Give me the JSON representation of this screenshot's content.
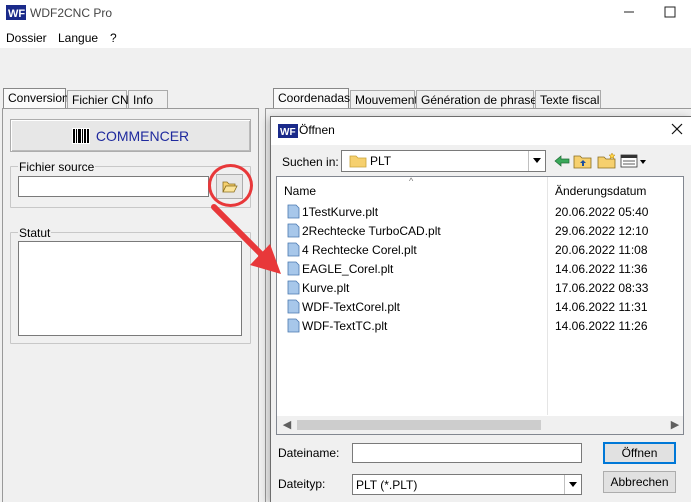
{
  "window": {
    "title": "WDF2CNC Pro",
    "app_icon": "wdf-app-icon",
    "controls": [
      "minimize-icon",
      "maximize-icon"
    ]
  },
  "menubar": {
    "items": [
      {
        "label": "Dossier"
      },
      {
        "label": "Langue"
      },
      {
        "label": "?"
      }
    ]
  },
  "left_tabs": [
    {
      "label": "Conversion",
      "active": true
    },
    {
      "label": "Fichier CN",
      "active": false
    },
    {
      "label": "Info",
      "active": false
    }
  ],
  "right_tabs": [
    {
      "label": "Coordenadas",
      "active": true
    },
    {
      "label": "Mouvement",
      "active": false
    },
    {
      "label": "Génération de phrases",
      "active": false
    },
    {
      "label": "Texte fiscal",
      "active": false
    }
  ],
  "conversion": {
    "start_button": "COMMENCER",
    "start_icon": "barcode-icon",
    "source_group": "Fichier source",
    "source_value": "",
    "browse_icon": "open-folder-icon",
    "status_group": "Statut",
    "status_text": ""
  },
  "dialog": {
    "title": "Öffnen",
    "icon": "wdf-app-icon",
    "look_in_label": "Suchen in:",
    "look_in_value": "PLT",
    "toolbar_icons": [
      "back-icon",
      "up-folder-icon",
      "new-folder-icon",
      "view-menu-icon"
    ],
    "columns": {
      "name": "Name",
      "date": "Änderungsdatum"
    },
    "files": [
      {
        "name": "1TestKurve.plt",
        "date": "20.06.2022 05:40"
      },
      {
        "name": "2Rechtecke TurboCAD.plt",
        "date": "29.06.2022 12:10"
      },
      {
        "name": "4 Rechtecke Corel.plt",
        "date": "20.06.2022 11:08"
      },
      {
        "name": "EAGLE_Corel.plt",
        "date": "14.06.2022 11:36"
      },
      {
        "name": "Kurve.plt",
        "date": "17.06.2022 08:33"
      },
      {
        "name": "WDF-TextCorel.plt",
        "date": "14.06.2022 11:31"
      },
      {
        "name": "WDF-TextTC.plt",
        "date": "14.06.2022 11:26"
      }
    ],
    "filename_label": "Dateiname:",
    "filename_value": "",
    "filetype_label": "Dateityp:",
    "filetype_value": "PLT (*.PLT)",
    "open_button": "Öffnen",
    "cancel_button": "Abbrechen"
  },
  "colors": {
    "annotation": "#e8383a",
    "start_text": "#1f2a9e",
    "folder": "#f6d06e",
    "file_icon": "#a7c7ea"
  }
}
